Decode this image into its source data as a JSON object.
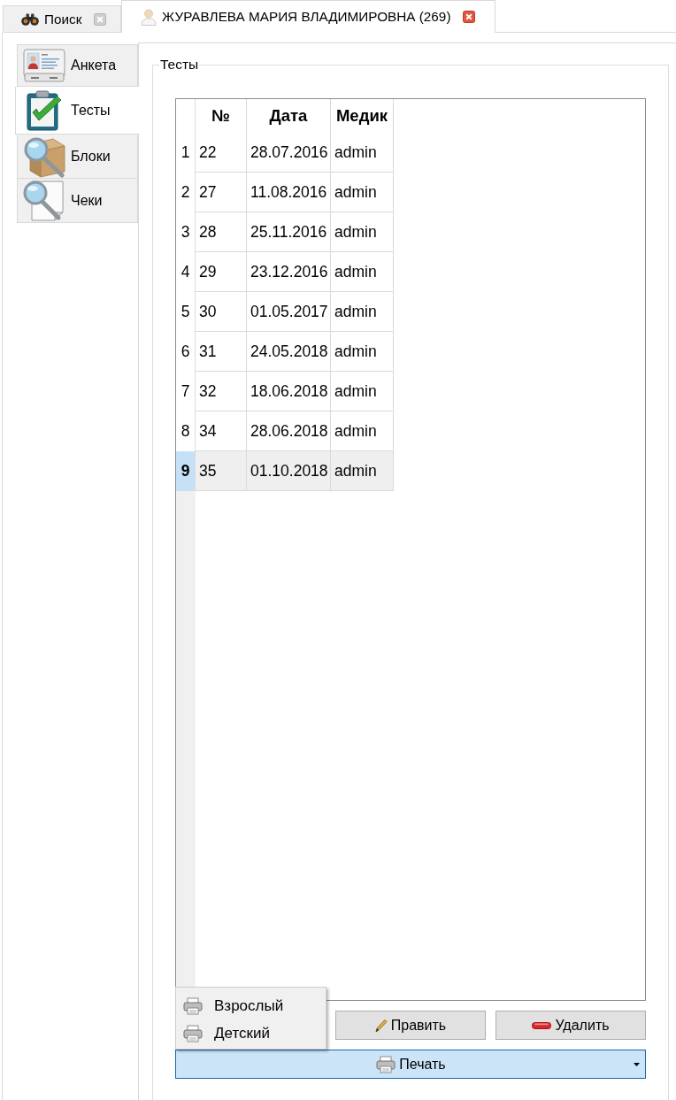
{
  "tabs": [
    {
      "label": "Поиск",
      "selected": false
    },
    {
      "label": "ЖУРАВЛЕВА МАРИЯ ВЛАДИМИРОВНА (269)",
      "selected": true
    }
  ],
  "side_tabs": [
    {
      "label": "Анкета",
      "selected": false
    },
    {
      "label": "Тесты",
      "selected": true
    },
    {
      "label": "Блоки",
      "selected": false
    },
    {
      "label": "Чеки",
      "selected": false
    }
  ],
  "group": {
    "title": "Тесты"
  },
  "table": {
    "columns": [
      "№",
      "Дата",
      "Медик"
    ],
    "rows": [
      {
        "number": "1",
        "cells": [
          "22",
          "28.07.2016",
          "admin"
        ],
        "selected": false
      },
      {
        "number": "2",
        "cells": [
          "27",
          "11.08.2016",
          "admin"
        ],
        "selected": false
      },
      {
        "number": "3",
        "cells": [
          "28",
          "25.11.2016",
          "admin"
        ],
        "selected": false
      },
      {
        "number": "4",
        "cells": [
          "29",
          "23.12.2016",
          "admin"
        ],
        "selected": false
      },
      {
        "number": "5",
        "cells": [
          "30",
          "01.05.2017",
          "admin"
        ],
        "selected": false
      },
      {
        "number": "6",
        "cells": [
          "31",
          "24.05.2018",
          "admin"
        ],
        "selected": false
      },
      {
        "number": "7",
        "cells": [
          "32",
          "18.06.2018",
          "admin"
        ],
        "selected": false
      },
      {
        "number": "8",
        "cells": [
          "34",
          "28.06.2018",
          "admin"
        ],
        "selected": false
      },
      {
        "number": "9",
        "cells": [
          "35",
          "01.10.2018",
          "admin"
        ],
        "selected": true
      }
    ]
  },
  "buttons": [
    {
      "label": "Править"
    },
    {
      "label": "Удалить"
    }
  ],
  "print_button": {
    "label": "Печать",
    "expanded": true,
    "menu": [
      {
        "label": "Взрослый"
      },
      {
        "label": "Детский"
      }
    ]
  }
}
